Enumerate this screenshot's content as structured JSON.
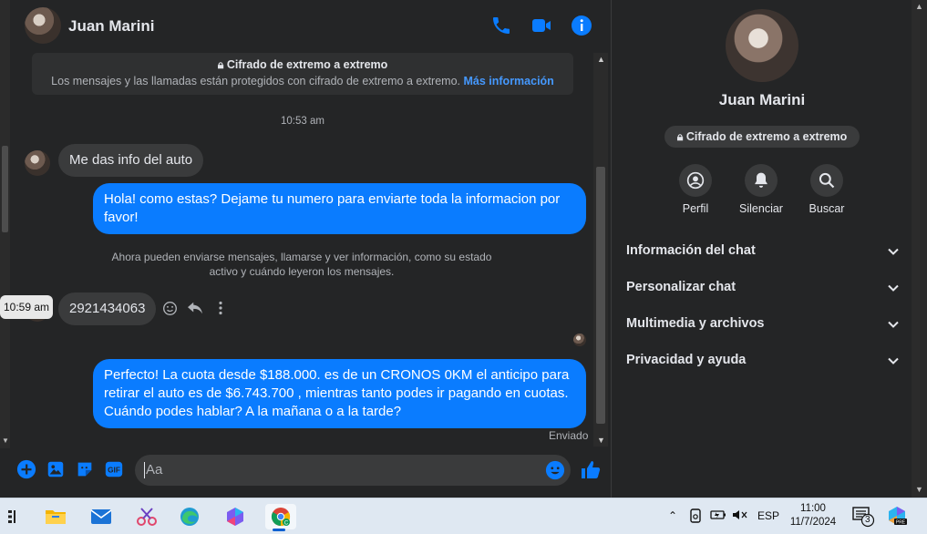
{
  "chat": {
    "contact_name": "Juan Marini",
    "banner": {
      "title": "Cifrado de extremo a extremo",
      "body": "Los mensajes y las llamadas están protegidos con cifrado de extremo a extremo.",
      "link": "Más información"
    },
    "timestamp": "10:53 am",
    "messages": [
      {
        "direction": "in",
        "text": "Me das info del auto"
      },
      {
        "direction": "out",
        "text": "Hola! como estas? Dejame tu numero para enviarte toda la informacion por favor!"
      },
      {
        "direction": "in",
        "text": "2921434063",
        "tooltip": "10:59 am"
      },
      {
        "direction": "out",
        "text": "Perfecto! La cuota desde $188.000. es de un CRONOS 0KM el anticipo para retirar el auto es de $6.743.700 , mientras tanto podes ir pagando en cuotas. Cuándo podes hablar? A la mañana o a la tarde?"
      }
    ],
    "notice": "Ahora pueden enviarse mensajes, llamarse y ver información, como su estado activo y cuándo leyeron los mensajes.",
    "sent_status": "Enviado",
    "composer_placeholder": "Aa"
  },
  "info": {
    "name": "Juan Marini",
    "encryption_pill": "Cifrado de extremo a extremo",
    "actions": [
      "Perfil",
      "Silenciar",
      "Buscar"
    ],
    "sections": [
      "Información del chat",
      "Personalizar chat",
      "Multimedia y archivos",
      "Privacidad y ayuda"
    ]
  },
  "taskbar": {
    "language": "ESP",
    "time": "11:00",
    "date": "11/7/2024",
    "notification_count": "3"
  },
  "colors": {
    "accent": "#0a7cff",
    "background": "#242526",
    "bubble_in": "#3a3b3c"
  }
}
